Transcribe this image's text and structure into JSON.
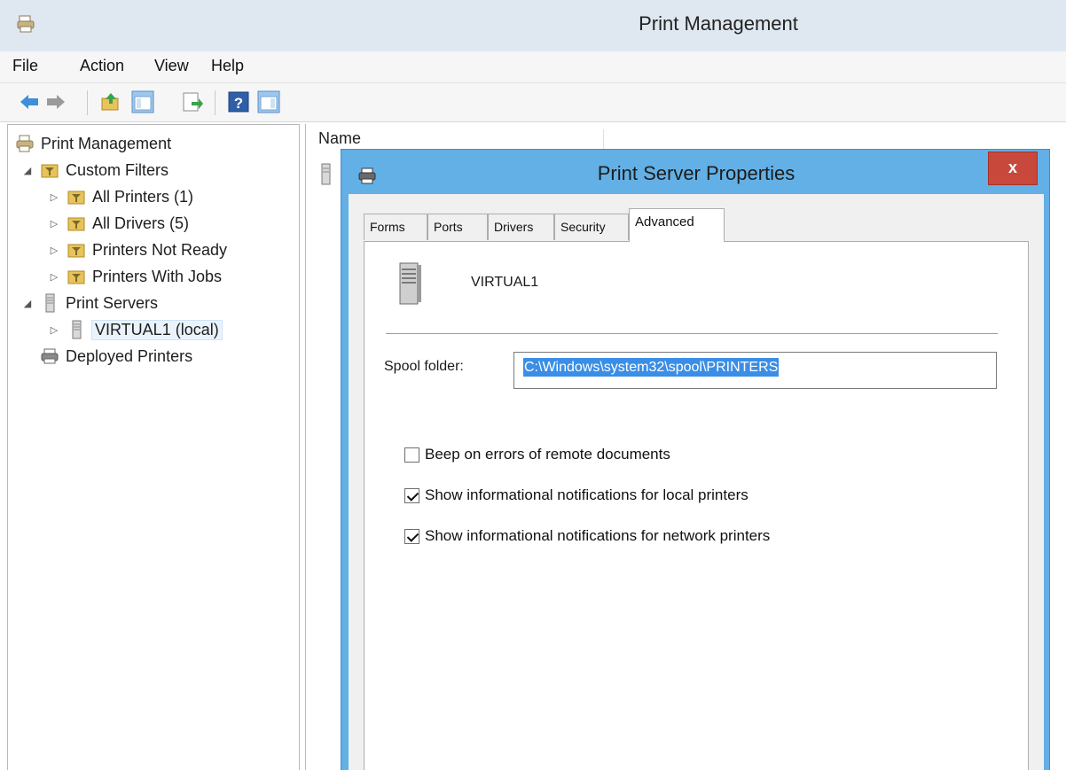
{
  "app": {
    "title": "Print Management"
  },
  "menu": [
    "File",
    "Action",
    "View",
    "Help"
  ],
  "toolbar": {
    "buttons": [
      "back-icon",
      "forward-icon",
      "up-folder-icon",
      "show-hide-console-tree-icon",
      "export-list-icon",
      "help-icon",
      "show-hide-action-pane-icon"
    ]
  },
  "tree": {
    "root": "Print Management",
    "custom_filters": "Custom Filters",
    "filters": [
      "All Printers (1)",
      "All Drivers (5)",
      "Printers Not Ready",
      "Printers With Jobs"
    ],
    "print_servers": "Print Servers",
    "server": "VIRTUAL1 (local)",
    "deployed": "Deployed Printers"
  },
  "list": {
    "column_name": "Name"
  },
  "dialog": {
    "title": "Print Server Properties",
    "close_label": "x",
    "tabs": [
      "Forms",
      "Ports",
      "Drivers",
      "Security",
      "Advanced"
    ],
    "active_tab": "Advanced",
    "server_name": "VIRTUAL1",
    "spool_label": "Spool folder:",
    "spool_value": "C:\\Windows\\system32\\spool\\PRINTERS",
    "checkboxes": [
      {
        "label": "Beep on errors of remote documents",
        "checked": false
      },
      {
        "label": "Show informational notifications for local printers",
        "checked": true
      },
      {
        "label": "Show informational notifications for network printers",
        "checked": true
      }
    ]
  },
  "colors": {
    "dialog_frame": "#63b0e6",
    "close_button": "#c9483c",
    "selection": "#3a8ee6"
  }
}
